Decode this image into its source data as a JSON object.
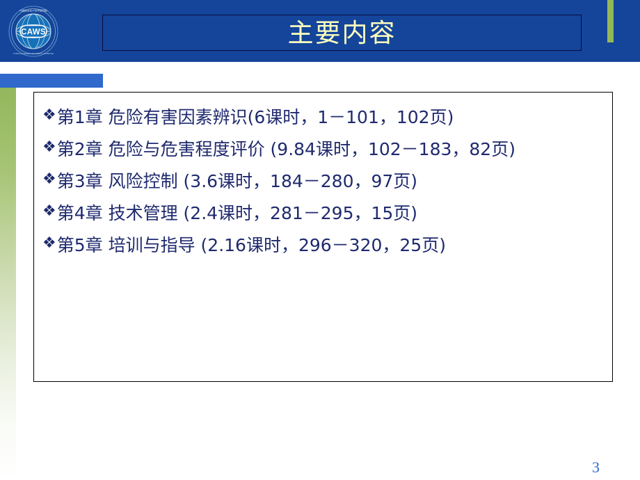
{
  "slide": {
    "page_number": "3",
    "background_color": "#FFFFFF"
  },
  "header": {
    "background_color": "#14459A",
    "title": "主要内容",
    "title_color": "#FFFFBE",
    "logo": {
      "name": "caws-logo",
      "center_text": "CAWS",
      "outer_ring_color": "#1B5FA8",
      "globe_color": "#1E86C8"
    },
    "accent_bar_green_color": "#92B857",
    "accent_bar_blue_color": "#3068CC"
  },
  "sidebar": {
    "gradient_top_color": "#93B75C",
    "gradient_bottom_color": "#FFFFFF"
  },
  "content": {
    "border_color": "#000000",
    "text_color": "#1F2A6E",
    "bullet_glyph": "❖",
    "items": [
      {
        "text": "第1章  危险有害因素辨识(6课时，1－101，102页)"
      },
      {
        "text": "第2章  危险与危害程度评价 (9.84课时，102－183，82页)"
      },
      {
        "text": "第3章  风险控制 (3.6课时，184－280，97页)"
      },
      {
        "text": "第4章  技术管理 (2.4课时，281－295，15页)"
      },
      {
        "text": "第5章  培训与指导 (2.16课时，296－320，25页)"
      }
    ]
  }
}
